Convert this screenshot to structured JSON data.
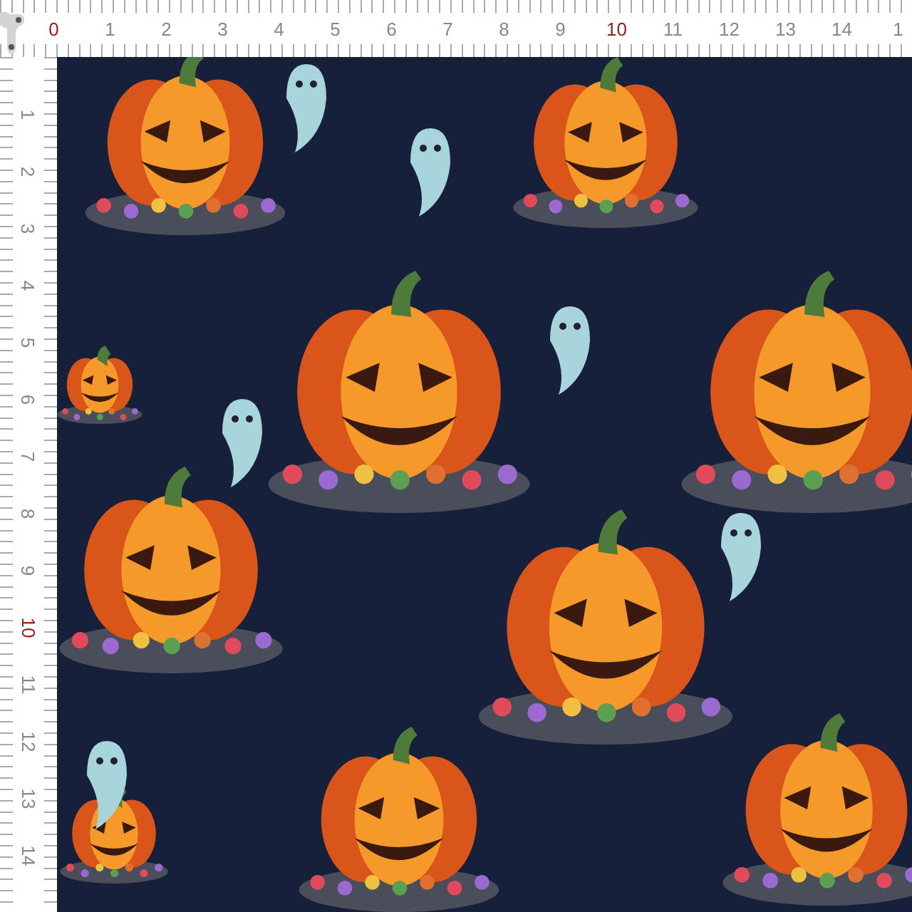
{
  "top_ruler": {
    "labels": [
      {
        "text": "0",
        "highlighted": true
      },
      {
        "text": "1",
        "highlighted": false
      },
      {
        "text": "2",
        "highlighted": false
      },
      {
        "text": "3",
        "highlighted": false
      },
      {
        "text": "4",
        "highlighted": false
      },
      {
        "text": "5",
        "highlighted": false
      },
      {
        "text": "6",
        "highlighted": false
      },
      {
        "text": "7",
        "highlighted": false
      },
      {
        "text": "8",
        "highlighted": false
      },
      {
        "text": "9",
        "highlighted": false
      },
      {
        "text": "10",
        "highlighted": true
      },
      {
        "text": "11",
        "highlighted": false
      },
      {
        "text": "12",
        "highlighted": false
      },
      {
        "text": "13",
        "highlighted": false
      },
      {
        "text": "14",
        "highlighted": false
      },
      {
        "text": "1",
        "highlighted": false
      }
    ]
  },
  "side_ruler": {
    "labels": [
      {
        "text": "1",
        "highlighted": false
      },
      {
        "text": "2",
        "highlighted": false
      },
      {
        "text": "3",
        "highlighted": false
      },
      {
        "text": "4",
        "highlighted": false
      },
      {
        "text": "5",
        "highlighted": false
      },
      {
        "text": "6",
        "highlighted": false
      },
      {
        "text": "7",
        "highlighted": false
      },
      {
        "text": "8",
        "highlighted": false
      },
      {
        "text": "9",
        "highlighted": false
      },
      {
        "text": "10",
        "highlighted": true
      },
      {
        "text": "11",
        "highlighted": false
      },
      {
        "text": "12",
        "highlighted": false
      },
      {
        "text": "13",
        "highlighted": false
      },
      {
        "text": "14",
        "highlighted": false
      }
    ]
  }
}
